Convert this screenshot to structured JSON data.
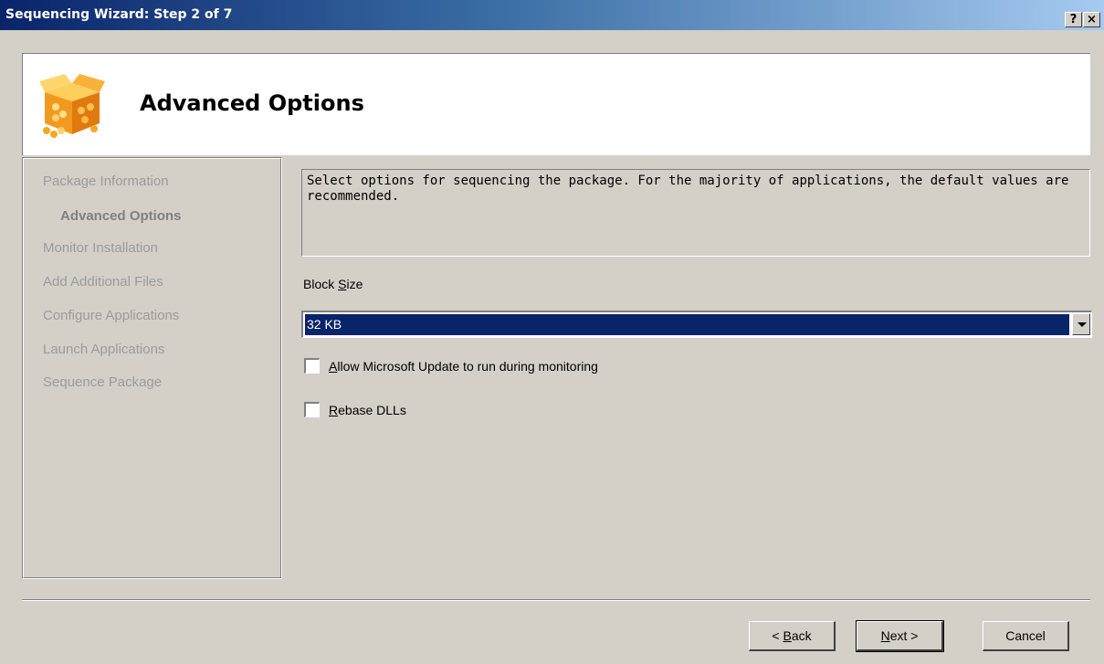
{
  "window": {
    "title": "Sequencing Wizard: Step 2 of 7",
    "help_glyph": "?",
    "close_glyph": "×"
  },
  "header": {
    "title": "Advanced Options",
    "icon": "package-box-icon"
  },
  "nav": {
    "items": [
      {
        "label": "Package Information",
        "state": "inactive"
      },
      {
        "label": "Advanced Options",
        "state": "active"
      },
      {
        "label": "Monitor Installation",
        "state": "inactive"
      },
      {
        "label": "Add Additional Files",
        "state": "inactive"
      },
      {
        "label": "Configure Applications",
        "state": "inactive"
      },
      {
        "label": "Launch Applications",
        "state": "inactive"
      },
      {
        "label": "Sequence Package",
        "state": "inactive"
      }
    ]
  },
  "main": {
    "description": "Select options for sequencing the package.  For the majority of applications, the default values are recommended.",
    "block_size": {
      "label_pre": "Block ",
      "label_key": "S",
      "label_post": "ize",
      "value": "32 KB"
    },
    "options": [
      {
        "label_key": "A",
        "label_rest": "llow Microsoft Update to run during monitoring",
        "checked": false
      },
      {
        "label_key": "R",
        "label_rest": "ebase DLLs",
        "checked": false
      }
    ]
  },
  "buttons": {
    "back": {
      "pre": "< ",
      "key": "B",
      "post": "ack"
    },
    "next": {
      "pre": "",
      "key": "N",
      "post": "ext >"
    },
    "cancel": {
      "label": "Cancel"
    }
  },
  "colors": {
    "titlebar_start": "#0a246a",
    "titlebar_end": "#a6caf0",
    "selection": "#0a246a",
    "face": "#d4d0c8"
  }
}
